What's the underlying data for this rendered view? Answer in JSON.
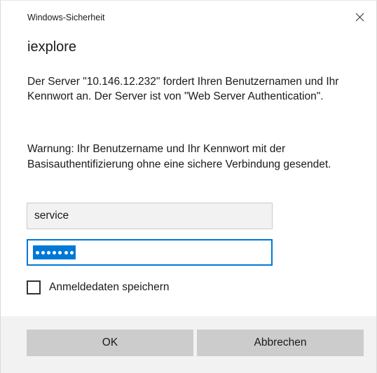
{
  "window": {
    "caption": "Windows-Sicherheit",
    "close_glyph": "✕"
  },
  "app": {
    "title": "iexplore"
  },
  "message": {
    "text": "Der Server \"10.146.12.232\" fordert Ihren Benutzernamen und Ihr Kennwort an. Der Server ist von \"Web Server Authentication\".",
    "warning": "Warnung: Ihr Benutzername und Ihr Kennwort mit der Basisauthentifizierung ohne eine sichere Verbindung gesendet."
  },
  "form": {
    "username_value": "service",
    "password_mask_count": 7,
    "password_selected": true,
    "remember_label": "Anmeldedaten speichern",
    "remember_checked": false
  },
  "buttons": {
    "ok_label": "OK",
    "cancel_label": "Abbrechen"
  },
  "colors": {
    "accent": "#0078d7",
    "button_bg": "#cccccc",
    "footer_bg": "#f2f2f2"
  },
  "icons": {
    "close": "close-icon",
    "checkbox": "checkbox-unchecked-icon"
  }
}
